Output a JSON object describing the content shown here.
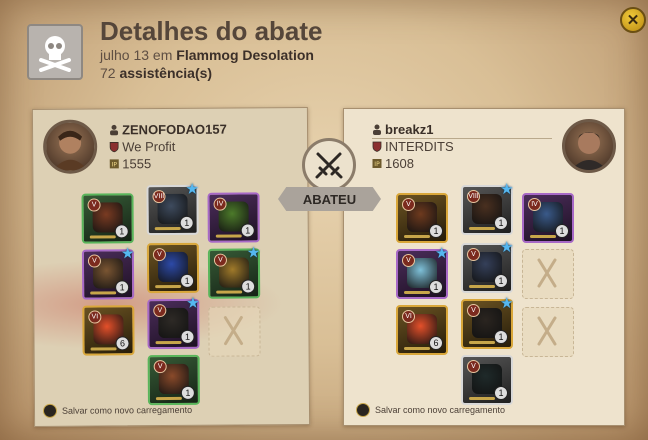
{
  "header": {
    "title": "Detalhes do abate",
    "date_prefix": "julho 13 em",
    "location": "Flammog Desolation",
    "assist_count": "72",
    "assist_label": "assistência(s)",
    "icon": "skull-crossbones-icon"
  },
  "killer": {
    "name": "ZENOFODAO157",
    "guild": "We Profit",
    "ip": "1555"
  },
  "victim": {
    "name": "breakz1",
    "guild": "INTERDITS",
    "ip": "1608"
  },
  "center": {
    "ribbon": "ABATEU",
    "icon": "crossed-swords-icon"
  },
  "save_loadout_label": "Salvar como novo carregamento",
  "colors": {
    "panel_left": "#ddd0b4",
    "panel_right": "#eee3cd",
    "accent_gold": "#f0c93a",
    "star_blue": "#55b7f0"
  },
  "killer_items": [
    {
      "name": "bag-slot",
      "tier": "V",
      "count": "1",
      "quality": "green",
      "art": "#7a3b22"
    },
    {
      "name": "head-slot",
      "tier": "VIII",
      "count": "1",
      "quality": "white",
      "art": "#3e4b5e",
      "star": true
    },
    {
      "name": "cape-slot",
      "tier": "IV",
      "count": "1",
      "quality": "purple",
      "art": "#4c7a2a"
    },
    {
      "name": "weapon-slot",
      "tier": "V",
      "count": "1",
      "quality": "purple",
      "art": "#7a5532",
      "star": true
    },
    {
      "name": "armor-slot",
      "tier": "V",
      "count": "1",
      "quality": "gold",
      "art": "#2d4aa8"
    },
    {
      "name": "offhand-slot",
      "tier": "V",
      "count": "1",
      "quality": "green",
      "art": "#a07a2a",
      "star": true
    },
    {
      "name": "potion-slot",
      "tier": "VI",
      "count": "6",
      "quality": "gold",
      "art": "#e4502a"
    },
    {
      "name": "shoes-slot",
      "tier": "V",
      "count": "1",
      "quality": "purple",
      "art": "#2e2a26",
      "star": true
    },
    {
      "name": "food-slot",
      "tier": "",
      "count": "",
      "quality": "empty",
      "art": ""
    },
    {
      "name": "mount-slot",
      "tier": "V",
      "count": "1",
      "quality": "green",
      "art": "#8a4a2a"
    }
  ],
  "victim_items": [
    {
      "name": "bag-slot",
      "tier": "V",
      "count": "1",
      "quality": "gold",
      "art": "#6e3a1e"
    },
    {
      "name": "head-slot",
      "tier": "VIII",
      "count": "1",
      "quality": "white",
      "art": "#4a3020",
      "star": true
    },
    {
      "name": "cape-slot",
      "tier": "IV",
      "count": "1",
      "quality": "purple",
      "art": "#3a5a8a"
    },
    {
      "name": "weapon-slot",
      "tier": "V",
      "count": "1",
      "quality": "purple",
      "art": "#7ec0d8",
      "star": true
    },
    {
      "name": "armor-slot",
      "tier": "V",
      "count": "1",
      "quality": "white",
      "art": "#35405a",
      "star": true
    },
    {
      "name": "offhand-slot",
      "tier": "",
      "count": "",
      "quality": "empty",
      "art": ""
    },
    {
      "name": "potion-slot",
      "tier": "VI",
      "count": "6",
      "quality": "gold",
      "art": "#e4502a"
    },
    {
      "name": "shoes-slot",
      "tier": "V",
      "count": "1",
      "quality": "gold",
      "art": "#2b2520",
      "star": true
    },
    {
      "name": "food-slot",
      "tier": "",
      "count": "",
      "quality": "empty",
      "art": ""
    },
    {
      "name": "mount-slot",
      "tier": "V",
      "count": "1",
      "quality": "white",
      "art": "#1f2a2a"
    }
  ]
}
